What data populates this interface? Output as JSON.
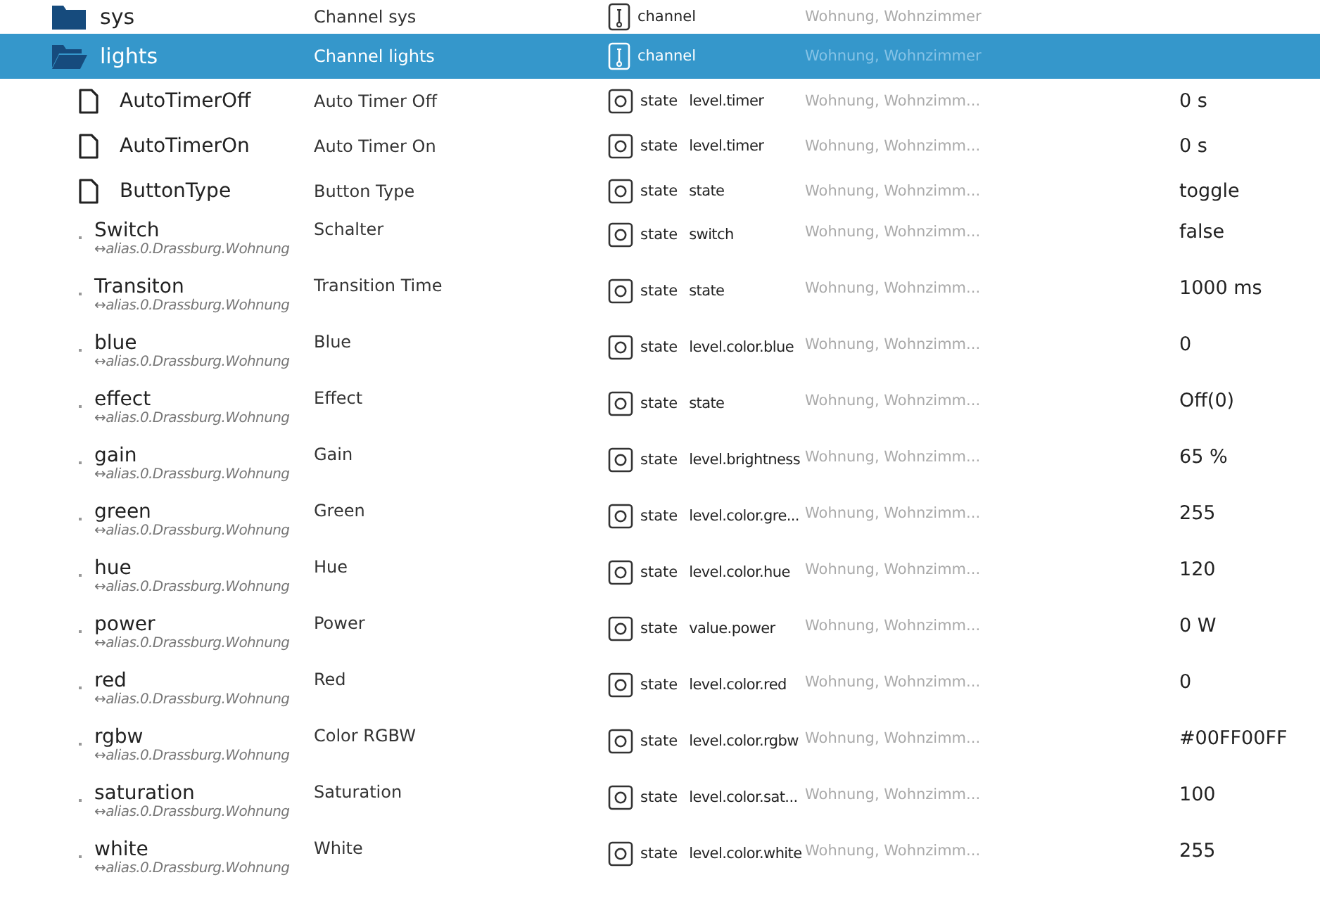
{
  "rows": [
    {
      "kind": "folder",
      "name": "sys",
      "description": "Channel sys",
      "type": "channel",
      "room": "Wohnung, Wohnzimmer",
      "expanded": false,
      "selected": false
    },
    {
      "kind": "folder",
      "name": "lights",
      "description": "Channel lights",
      "type": "channel",
      "room": "Wohnung, Wohnzimmer",
      "expanded": true,
      "selected": true
    },
    {
      "kind": "file",
      "name": "AutoTimerOff",
      "description": "Auto Timer Off",
      "type": "state",
      "role": "level.timer",
      "room": "Wohnung, Wohnzimm...",
      "value": "0 s",
      "selected": false
    },
    {
      "kind": "file",
      "name": "AutoTimerOn",
      "description": "Auto Timer On",
      "type": "state",
      "role": "level.timer",
      "room": "Wohnung, Wohnzimm...",
      "value": "0 s",
      "selected": false
    },
    {
      "kind": "file",
      "name": "ButtonType",
      "description": "Button Type",
      "type": "state",
      "role": "state",
      "room": "Wohnung, Wohnzimm...",
      "value": "toggle",
      "selected": false
    },
    {
      "kind": "alias",
      "name": "Switch",
      "alias": "↔alias.0.Drassburg.Wohnung",
      "description": "Schalter",
      "type": "state",
      "role": "switch",
      "room": "Wohnung, Wohnzimm...",
      "value": "false",
      "selected": false
    },
    {
      "kind": "alias",
      "name": "Transiton",
      "alias": "↔alias.0.Drassburg.Wohnung",
      "description": "Transition Time",
      "type": "state",
      "role": "state",
      "room": "Wohnung, Wohnzimm...",
      "value": "1000 ms",
      "selected": false
    },
    {
      "kind": "alias",
      "name": "blue",
      "alias": "↔alias.0.Drassburg.Wohnung",
      "description": "Blue",
      "type": "state",
      "role": "level.color.blue",
      "room": "Wohnung, Wohnzimm...",
      "value": "0",
      "selected": false
    },
    {
      "kind": "alias",
      "name": "effect",
      "alias": "↔alias.0.Drassburg.Wohnung",
      "description": "Effect",
      "type": "state",
      "role": "state",
      "room": "Wohnung, Wohnzimm...",
      "value": "Off(0)",
      "selected": false
    },
    {
      "kind": "alias",
      "name": "gain",
      "alias": "↔alias.0.Drassburg.Wohnung",
      "description": "Gain",
      "type": "state",
      "role": "level.brightness",
      "room": "Wohnung, Wohnzimm...",
      "value": "65 %",
      "selected": false
    },
    {
      "kind": "alias",
      "name": "green",
      "alias": "↔alias.0.Drassburg.Wohnung",
      "description": "Green",
      "type": "state",
      "role": "level.color.gre...",
      "room": "Wohnung, Wohnzimm...",
      "value": "255",
      "selected": false
    },
    {
      "kind": "alias",
      "name": "hue",
      "alias": "↔alias.0.Drassburg.Wohnung",
      "description": "Hue",
      "type": "state",
      "role": "level.color.hue",
      "room": "Wohnung, Wohnzimm...",
      "value": "120",
      "selected": false
    },
    {
      "kind": "alias",
      "name": "power",
      "alias": "↔alias.0.Drassburg.Wohnung",
      "description": "Power",
      "type": "state",
      "role": "value.power",
      "room": "Wohnung, Wohnzimm...",
      "value": "0 W",
      "selected": false
    },
    {
      "kind": "alias",
      "name": "red",
      "alias": "↔alias.0.Drassburg.Wohnung",
      "description": "Red",
      "type": "state",
      "role": "level.color.red",
      "room": "Wohnung, Wohnzimm...",
      "value": "0",
      "selected": false
    },
    {
      "kind": "alias",
      "name": "rgbw",
      "alias": "↔alias.0.Drassburg.Wohnung",
      "description": "Color RGBW",
      "type": "state",
      "role": "level.color.rgbw",
      "room": "Wohnung, Wohnzimm...",
      "value": "#00FF00FF",
      "selected": false
    },
    {
      "kind": "alias",
      "name": "saturation",
      "alias": "↔alias.0.Drassburg.Wohnung",
      "description": "Saturation",
      "type": "state",
      "role": "level.color.sat...",
      "room": "Wohnung, Wohnzimm...",
      "value": "100",
      "selected": false
    },
    {
      "kind": "alias",
      "name": "white",
      "alias": "↔alias.0.Drassburg.Wohnung",
      "description": "White",
      "type": "state",
      "role": "level.color.white",
      "room": "Wohnung, Wohnzimm...",
      "value": "255",
      "selected": false
    }
  ]
}
